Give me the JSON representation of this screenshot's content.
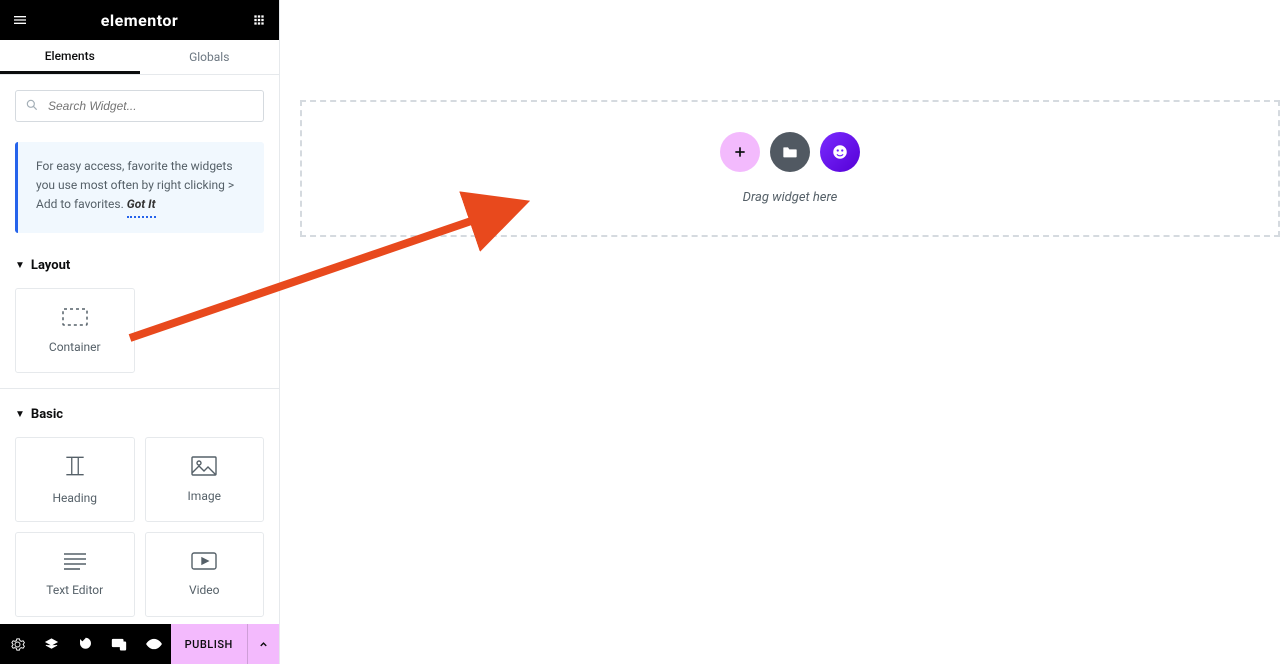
{
  "header": {
    "brand": "elementor"
  },
  "tabs": {
    "elements": "Elements",
    "globals": "Globals"
  },
  "search": {
    "placeholder": "Search Widget..."
  },
  "tip": {
    "text": "For easy access, favorite the widgets you use most often by right clicking > Add to favorites.",
    "gotit": "Got It"
  },
  "cats": {
    "layout": {
      "title": "Layout",
      "container": "Container"
    },
    "basic": {
      "title": "Basic",
      "heading": "Heading",
      "image": "Image",
      "text": "Text Editor",
      "video": "Video"
    }
  },
  "footer": {
    "publish": "PUBLISH"
  },
  "canvas": {
    "hint": "Drag widget here"
  }
}
